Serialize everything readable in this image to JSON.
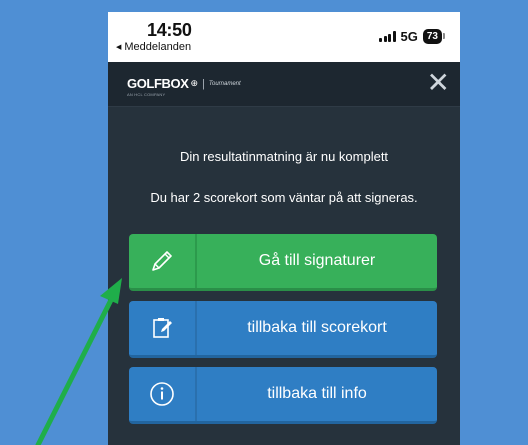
{
  "status_bar": {
    "time": "14:50",
    "back_label": "Meddelanden",
    "network": "5G",
    "battery": "73"
  },
  "header": {
    "logo_text": "GOLFBOX",
    "logo_suffix": "Tournament",
    "logo_sub": "AN HCL COMPANY",
    "close_icon": "close-icon"
  },
  "content": {
    "message_complete": "Din resultatinmatning är nu komplett",
    "message_pending": "Du har 2 scorekort som väntar på att signeras."
  },
  "buttons": [
    {
      "label": "Gå till signaturer",
      "icon": "pen-icon",
      "color": "#37b05a"
    },
    {
      "label": "tillbaka till scorekort",
      "icon": "clipboard-edit-icon",
      "color": "#2f7ec4"
    },
    {
      "label": "tillbaka till info",
      "icon": "info-icon",
      "color": "#2f7ec4"
    }
  ],
  "colors": {
    "background": "#4f8fd4",
    "panel": "#26323c",
    "appbar": "#1d2730",
    "arrow": "#1fae4a"
  }
}
